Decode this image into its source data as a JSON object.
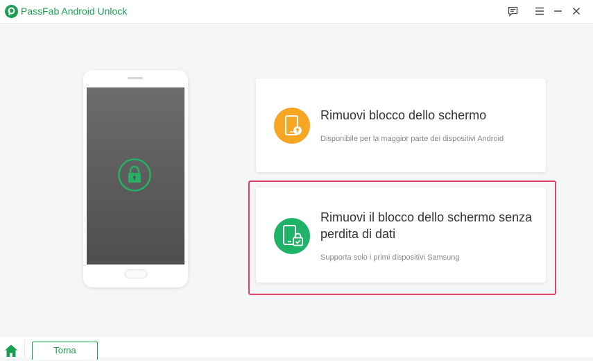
{
  "app": {
    "title": "PassFab Android Unlock",
    "brand_color": "#1a9e52"
  },
  "titlebar": {
    "icons": [
      "feedback-icon",
      "menu-icon",
      "minimize-icon",
      "close-icon"
    ]
  },
  "options": [
    {
      "title": "Rimuovi blocco dello schermo",
      "subtitle": "Disponibile per la maggior parte dei dispositivi Android",
      "icon": "phone-key-icon",
      "icon_color": "#f6a623",
      "selected": false
    },
    {
      "title": "Rimuovi il blocco dello schermo senza perdita di dati",
      "subtitle": "Supporta solo i primi dispositivi Samsung",
      "icon": "phone-lock-icon",
      "icon_color": "#1fb369",
      "selected": true,
      "selection_color": "#e3406a"
    }
  ],
  "footer": {
    "back_label": "Torna",
    "home_icon": "home-icon"
  }
}
